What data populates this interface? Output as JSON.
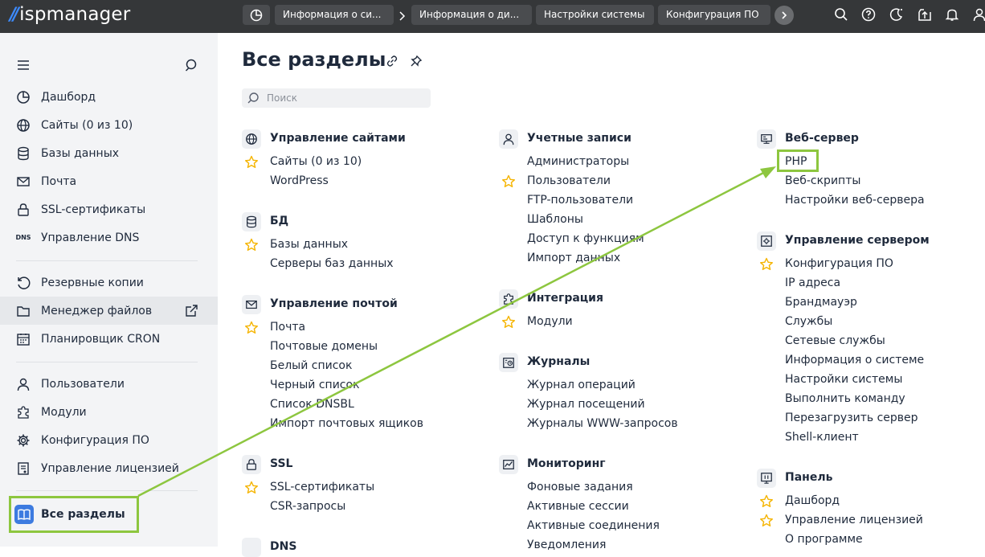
{
  "brand": {
    "mark": "//",
    "name": "ispmanager"
  },
  "topbar": {
    "tabs": [
      {
        "label": "Информация о си..."
      },
      {
        "label": "Информация о ди..."
      },
      {
        "label": "Настройки системы"
      },
      {
        "label": "Конфигурация ПО"
      }
    ],
    "icons": [
      "search-icon",
      "help-icon",
      "theme-icon",
      "upload-icon",
      "bell-icon",
      "user-icon"
    ]
  },
  "sidebar": {
    "items": [
      {
        "label": "Дашборд",
        "icon": "dashboard-icon"
      },
      {
        "label": "Сайты (0 из 10)",
        "icon": "globe-icon"
      },
      {
        "label": "Базы данных",
        "icon": "database-icon"
      },
      {
        "label": "Почта",
        "icon": "mail-icon"
      },
      {
        "label": "SSL-сертификаты",
        "icon": "lock-icon"
      },
      {
        "label": "Управление DNS",
        "icon": "dns-icon",
        "icon_text": "DNS"
      },
      {
        "label": "Резервные копии",
        "icon": "backup-icon"
      },
      {
        "label": "Менеджер файлов",
        "icon": "folder-icon"
      },
      {
        "label": "Планировщик CRON",
        "icon": "calendar-icon"
      },
      {
        "label": "Пользователи",
        "icon": "user-icon"
      },
      {
        "label": "Модули",
        "icon": "puzzle-icon"
      },
      {
        "label": "Конфигурация ПО",
        "icon": "gear-icon"
      },
      {
        "label": "Управление лицензией",
        "icon": "license-icon"
      }
    ],
    "current": {
      "label": "Все разделы",
      "icon": "book-icon"
    }
  },
  "main": {
    "title": "Все разделы",
    "search_placeholder": "Поиск",
    "col1": {
      "sections": [
        {
          "title": "Управление сайтами",
          "icon": "globe-icon",
          "links": [
            {
              "label": "Сайты (0 из 10)",
              "starred": true
            },
            {
              "label": "WordPress",
              "starred": false
            }
          ]
        },
        {
          "title": "БД",
          "icon": "database-icon",
          "links": [
            {
              "label": "Базы данных",
              "starred": true
            },
            {
              "label": "Серверы баз данных",
              "starred": false
            }
          ]
        },
        {
          "title": "Управление почтой",
          "icon": "mail-icon",
          "links": [
            {
              "label": "Почта",
              "starred": true
            },
            {
              "label": "Почтовые домены",
              "starred": false
            },
            {
              "label": "Белый список",
              "starred": false
            },
            {
              "label": "Черный список",
              "starred": false
            },
            {
              "label": "Список DNSBL",
              "starred": false
            },
            {
              "label": "Импорт почтовых ящиков",
              "starred": false
            }
          ]
        },
        {
          "title": "SSL",
          "icon": "lock-icon",
          "links": [
            {
              "label": "SSL-сертификаты",
              "starred": true
            },
            {
              "label": "CSR-запросы",
              "starred": false
            }
          ]
        },
        {
          "title": "DNS",
          "icon": "dns-icon",
          "links": []
        }
      ]
    },
    "col2": {
      "sections": [
        {
          "title": "Учетные записи",
          "icon": "user-icon",
          "links": [
            {
              "label": "Администраторы",
              "starred": false
            },
            {
              "label": "Пользователи",
              "starred": true
            },
            {
              "label": "FTP-пользователи",
              "starred": false
            },
            {
              "label": "Шаблоны",
              "starred": false
            },
            {
              "label": "Доступ к функциям",
              "starred": false
            },
            {
              "label": "Импорт данных",
              "starred": false
            }
          ]
        },
        {
          "title": "Интеграция",
          "icon": "puzzle-icon",
          "links": [
            {
              "label": "Модули",
              "starred": true
            }
          ]
        },
        {
          "title": "Журналы",
          "icon": "log-icon",
          "links": [
            {
              "label": "Журнал операций",
              "starred": false
            },
            {
              "label": "Журнал посещений",
              "starred": false
            },
            {
              "label": "Журналы WWW-запросов",
              "starred": false
            }
          ]
        },
        {
          "title": "Мониторинг",
          "icon": "chart-icon",
          "links": [
            {
              "label": "Фоновые задания",
              "starred": false
            },
            {
              "label": "Активные сессии",
              "starred": false
            },
            {
              "label": "Активные соединения",
              "starred": false
            },
            {
              "label": "Уведомления",
              "starred": false
            }
          ]
        }
      ]
    },
    "col3": {
      "sections": [
        {
          "title": "Веб-сервер",
          "icon": "server-icon",
          "links": [
            {
              "label": "PHP",
              "starred": false
            },
            {
              "label": "Веб-скрипты",
              "starred": false
            },
            {
              "label": "Настройки веб-сервера",
              "starred": false
            }
          ]
        },
        {
          "title": "Управление сервером",
          "icon": "server-settings-icon",
          "links": [
            {
              "label": "Конфигурация ПО",
              "starred": true
            },
            {
              "label": "IP адреса",
              "starred": false
            },
            {
              "label": "Брандмауэр",
              "starred": false
            },
            {
              "label": "Службы",
              "starred": false
            },
            {
              "label": "Сетевые службы",
              "starred": false
            },
            {
              "label": "Информация о системе",
              "starred": false
            },
            {
              "label": "Настройки системы",
              "starred": false
            },
            {
              "label": "Выполнить команду",
              "starred": false
            },
            {
              "label": "Перезагрузить сервер",
              "starred": false
            },
            {
              "label": "Shell-клиент",
              "starred": false
            }
          ]
        },
        {
          "title": "Панель",
          "icon": "panel-icon",
          "links": [
            {
              "label": "Дашборд",
              "starred": true
            },
            {
              "label": "Управление лицензией",
              "starred": true
            },
            {
              "label": "О программе",
              "starred": false
            }
          ]
        }
      ]
    }
  },
  "colors": {
    "accent": "#3d7be0",
    "highlight": "#8dc63f",
    "star": "#f5b400",
    "topbar": "#353739"
  }
}
